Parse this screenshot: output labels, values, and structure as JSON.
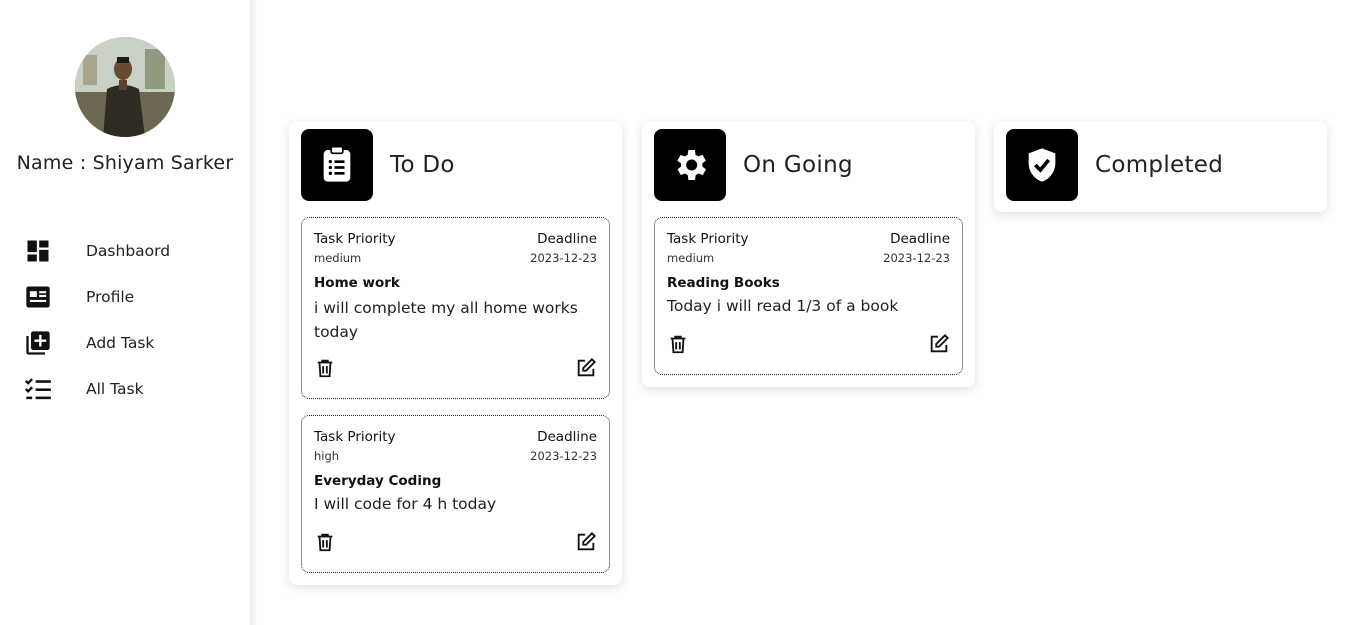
{
  "user": {
    "name": "Name : Shiyam Sarker",
    "avatar_icon": "profile-photo"
  },
  "nav": {
    "items": [
      {
        "label": "Dashbaord",
        "icon": "dashboard-icon"
      },
      {
        "label": "Profile",
        "icon": "profile-card-icon"
      },
      {
        "label": "Add Task",
        "icon": "add-box-icon"
      },
      {
        "label": "All Task",
        "icon": "checklist-icon"
      }
    ]
  },
  "columns": {
    "todo": {
      "title": "To Do",
      "icon": "clipboard-list-icon"
    },
    "ongoing": {
      "title": "On Going",
      "icon": "gear-icon"
    },
    "completed": {
      "title": "Completed",
      "icon": "shield-check-icon"
    }
  },
  "labels": {
    "priority": "Task Priority",
    "deadline": "Deadline"
  },
  "tasks": {
    "todo": [
      {
        "priority": "medium",
        "deadline": "2023-12-23",
        "title": "Home work",
        "description": "i will complete my all home works today"
      },
      {
        "priority": "high",
        "deadline": "2023-12-23",
        "title": "Everyday Coding",
        "description": "I will code for 4 h today"
      }
    ],
    "ongoing": [
      {
        "priority": "medium",
        "deadline": "2023-12-23",
        "title": "Reading Books",
        "description": "Today i will read 1/3 of a book"
      }
    ]
  },
  "colors": {
    "icon_bg": "#000000",
    "card_border": "#222222",
    "text": "#222222"
  }
}
